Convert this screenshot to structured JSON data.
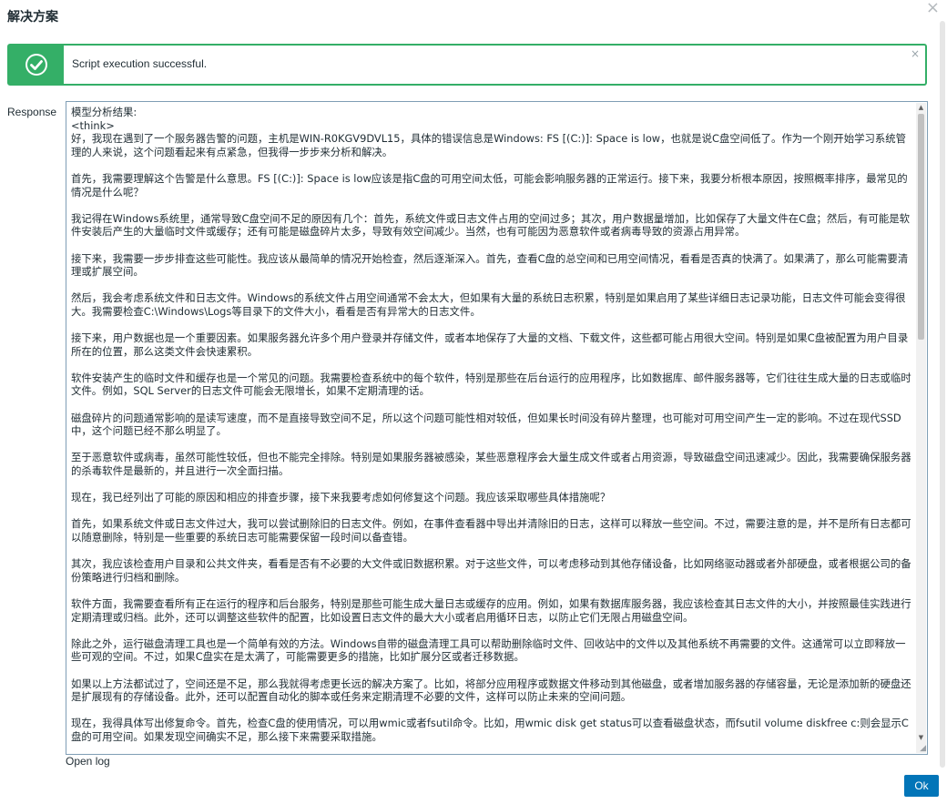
{
  "dialog": {
    "title": "解决方案",
    "close_glyph": "×"
  },
  "alert": {
    "message": "Script execution successful.",
    "close_glyph": "×",
    "icon": "check-circle-icon",
    "color": "#34af67"
  },
  "response": {
    "label": "Response",
    "text": "模型分析结果:\n<think>\n好，我现在遇到了一个服务器告警的问题，主机是WIN-R0KGV9DVL15，具体的错误信息是Windows: FS [(C:)]: Space is low，也就是说C盘空间低了。作为一个刚开始学习系统管理的人来说，这个问题看起来有点紧急，但我得一步步来分析和解决。\n\n首先，我需要理解这个告警是什么意思。FS [(C:)]: Space is low应该是指C盘的可用空间太低，可能会影响服务器的正常运行。接下来，我要分析根本原因，按照概率排序，最常见的情况是什么呢？\n\n我记得在Windows系统里，通常导致C盘空间不足的原因有几个：首先，系统文件或日志文件占用的空间过多；其次，用户数据量增加，比如保存了大量文件在C盘；然后，有可能是软件安装后产生的大量临时文件或缓存；还有可能是磁盘碎片太多，导致有效空间减少。当然，也有可能因为恶意软件或者病毒导致的资源占用异常。\n\n接下来，我需要一步步排查这些可能性。我应该从最简单的情况开始检查，然后逐渐深入。首先，查看C盘的总空间和已用空间情况，看看是否真的快满了。如果满了，那么可能需要清理或扩展空间。\n\n然后，我会考虑系统文件和日志文件。Windows的系统文件占用空间通常不会太大，但如果有大量的系统日志积累，特别是如果启用了某些详细日志记录功能，日志文件可能会变得很大。我需要检查C:\\Windows\\Logs等目录下的文件大小，看看是否有异常大的日志文件。\n\n接下来，用户数据也是一个重要因素。如果服务器允许多个用户登录并存储文件，或者本地保存了大量的文档、下载文件，这些都可能占用很大空间。特别是如果C盘被配置为用户目录所在的位置，那么这类文件会快速累积。\n\n软件安装产生的临时文件和缓存也是一个常见的问题。我需要检查系统中的每个软件，特别是那些在后台运行的应用程序，比如数据库、邮件服务器等，它们往往生成大量的日志或临时文件。例如，SQL Server的日志文件可能会无限增长，如果不定期清理的话。\n\n磁盘碎片的问题通常影响的是读写速度，而不是直接导致空间不足，所以这个问题可能性相对较低，但如果长时间没有碎片整理，也可能对可用空间产生一定的影响。不过在现代SSD中，这个问题已经不那么明显了。\n\n至于恶意软件或病毒，虽然可能性较低，但也不能完全排除。特别是如果服务器被感染，某些恶意程序会大量生成文件或者占用资源，导致磁盘空间迅速减少。因此，我需要确保服务器的杀毒软件是最新的，并且进行一次全面扫描。\n\n现在，我已经列出了可能的原因和相应的排查步骤，接下来我要考虑如何修复这个问题。我应该采取哪些具体措施呢？\n\n首先，如果系统文件或日志文件过大，我可以尝试删除旧的日志文件。例如，在事件查看器中导出并清除旧的日志，这样可以释放一些空间。不过，需要注意的是，并不是所有日志都可以随意删除，特别是一些重要的系统日志可能需要保留一段时间以备查错。\n\n其次，我应该检查用户目录和公共文件夹，看看是否有不必要的大文件或旧数据积累。对于这些文件，可以考虑移动到其他存储设备，比如网络驱动器或者外部硬盘，或者根据公司的备份策略进行归档和删除。\n\n软件方面，我需要查看所有正在运行的程序和后台服务，特别是那些可能生成大量日志或缓存的应用。例如，如果有数据库服务器，我应该检查其日志文件的大小，并按照最佳实践进行定期清理或归档。此外，还可以调整这些软件的配置，比如设置日志文件的最大大小或者启用循环日志，以防止它们无限占用磁盘空间。\n\n除此之外，运行磁盘清理工具也是一个简单有效的方法。Windows自带的磁盘清理工具可以帮助删除临时文件、回收站中的文件以及其他系统不再需要的文件。这通常可以立即释放一些可观的空间。不过，如果C盘实在是太满了，可能需要更多的措施，比如扩展分区或者迁移数据。\n\n如果以上方法都试过了，空间还是不足，那么我就得考虑更长远的解决方案了。比如，将部分应用程序或数据文件移动到其他磁盘，或者增加服务器的存储容量，无论是添加新的硬盘还是扩展现有的存储设备。此外，还可以配置自动化的脚本或任务来定期清理不必要的文件，这样可以防止未来的空间问题。\n\n现在，我得具体写出修复命令。首先，检查C盘的使用情况，可以用wmic或者fsutil命令。比如，用wmic disk get status可以查看磁盘状态，而fsutil volume diskfree c:则会显示C盘的可用空间。如果发现空间确实不足，那么接下来需要采取措施。"
  },
  "footer": {
    "open_log_label": "Open log",
    "ok_label": "Ok",
    "ok_color": "#0275b8"
  }
}
